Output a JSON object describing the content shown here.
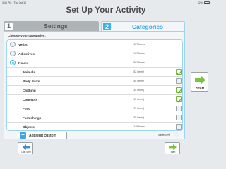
{
  "status_bar": {
    "time": "3:46 PM",
    "date": "Thu Oct 10",
    "battery": "52%"
  },
  "title": "Set Up Your Activity",
  "tabs": [
    {
      "number": "1",
      "label": "Settings"
    },
    {
      "number": "2",
      "label": "Categories"
    }
  ],
  "choose_label": "Choose your categories:",
  "categories": [
    {
      "label": "Verbs",
      "count": "(107 Items)"
    },
    {
      "label": "Adjectives",
      "count": "(107 Items)"
    },
    {
      "label": "Nouns",
      "count": "(507 Items)"
    }
  ],
  "subcategories": [
    {
      "label": "Animals",
      "count": "(52 Items)"
    },
    {
      "label": "Body Parts",
      "count": "(40 Items)"
    },
    {
      "label": "Clothing",
      "count": "(35 Items)"
    },
    {
      "label": "Concepts",
      "count": "(15 Items)"
    },
    {
      "label": "Food",
      "count": "(73 Items)"
    },
    {
      "label": "Furnishings",
      "count": "(35 Items)"
    },
    {
      "label": "Objects",
      "count": "(148 Items)"
    }
  ],
  "checked": [
    true,
    false,
    true,
    true,
    false,
    false,
    false
  ],
  "selected_category": "Nouns",
  "add_edit_label": "Add/edit custom",
  "select_all_label": "Select All",
  "start_label": "Start",
  "last_step_label": "Last Step",
  "colors": {
    "accent": "#39b2e5",
    "check": "#58a81a",
    "start_arrow": "#7cc242"
  }
}
